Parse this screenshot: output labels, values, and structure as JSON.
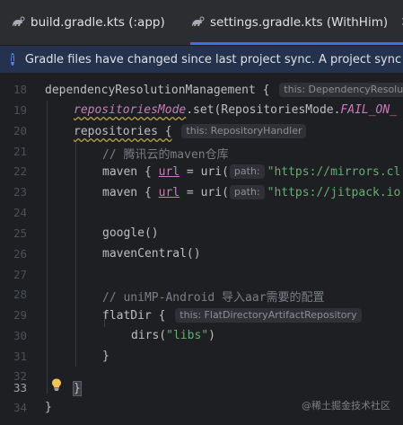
{
  "tabs": [
    {
      "label": "build.gradle.kts (:app)",
      "active": false
    },
    {
      "label": "settings.gradle.kts (WithHim)",
      "active": true
    }
  ],
  "banner": {
    "icon": "info-icon",
    "message": "Gradle files have changed since last project sync. A project sync m"
  },
  "editor": {
    "line_numbers": [
      "18",
      "19",
      "20",
      "21",
      "22",
      "23",
      "24",
      "25",
      "26",
      "27",
      "28",
      "29",
      "30",
      "31",
      "32",
      "33",
      "34"
    ],
    "current_line": "33",
    "hints": {
      "this_dependency": "this: DependencyResolu",
      "this_repository_handler": "this: RepositoryHandler",
      "path1": "path:",
      "path2": "path:",
      "this_flatdir": "this: FlatDirectoryArtifactRepository"
    },
    "code": {
      "l18": "dependencyResolutionManagement {",
      "l19_prop": "repositoriesMode",
      "l19_mid": ".set(RepositoriesMode.",
      "l19_static": "FAIL_ON_",
      "l20": "repositories {",
      "l21": "// 腾讯云的maven仓库",
      "l22_a": "maven { ",
      "l22_url": "url",
      "l22_b": " = uri(",
      "l22_str": "\"https://mirrors.cl",
      "l23_a": "maven { ",
      "l23_url": "url",
      "l23_b": " = uri(",
      "l23_str": "\"https://jitpack.io",
      "l25": "google()",
      "l26": "mavenCentral()",
      "l28": "// uniMP-Android 导入aar需要的配置",
      "l29": "flatDir {",
      "l30_a": "dirs(",
      "l30_str": "\"libs\"",
      "l30_b": ")",
      "l31": "}",
      "l33": "}",
      "l34": "}"
    }
  },
  "watermark": "@稀土掘金技术社区",
  "colors": {
    "accent": "#3574f0",
    "string": "#6aab73",
    "property": "#c77dbb",
    "comment": "#7a7e85"
  }
}
